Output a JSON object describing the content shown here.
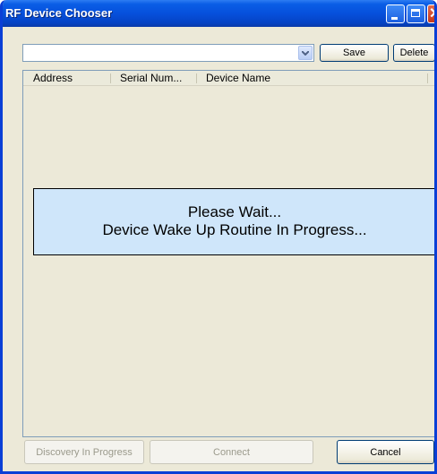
{
  "window": {
    "title": "RF Device Chooser"
  },
  "toolbar": {
    "combo_value": "",
    "save_label": "Save",
    "delete_label": "Delete"
  },
  "list": {
    "columns": [
      "Address",
      "Serial Num...",
      "Device Name"
    ]
  },
  "overlay": {
    "line1": "Please Wait...",
    "line2": "Device Wake Up Routine In Progress..."
  },
  "footer": {
    "discovery_label": "Discovery In Progress",
    "connect_label": "Connect",
    "cancel_label": "Cancel"
  },
  "colors": {
    "titlebar": "#0650dc",
    "window_bg": "#ece9d8",
    "overlay_bg": "#cfe6fa"
  }
}
